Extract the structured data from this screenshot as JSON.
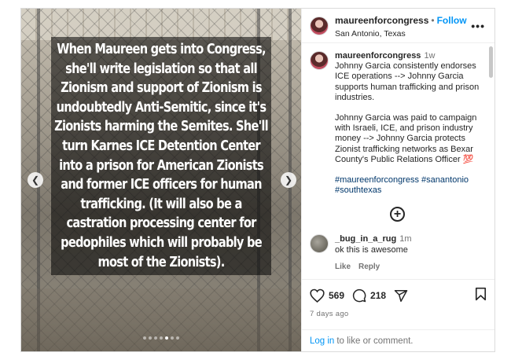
{
  "post": {
    "caption_image_text": "When Maureen gets into Congress, she'll write legislation so that all Zionism and support of Zionism is undoubtedly Anti-Semitic, since it's Zionists harming the Semites. She'll turn Karnes ICE Detention Center into a prison for American Zionists and former ICE officers for human trafficking. (It will also be a castration processing center for pedophiles which will probably be most of the Zionists).",
    "carousel": {
      "count": 7,
      "active": 5,
      "prev_icon": "chevron-left-icon",
      "next_icon": "chevron-right-icon"
    }
  },
  "header": {
    "username": "maureenforcongress",
    "separator": "•",
    "follow_label": "Follow",
    "location": "San Antonio, Texas",
    "more_icon": "ellipsis-icon",
    "more_label": "•••"
  },
  "caption_comment": {
    "username": "maureenforcongress",
    "time": "1w",
    "paragraph1": "Johnny Garcia consistently endorses ICE operations --> Johnny Garcia supports human trafficking and prison industries.",
    "paragraph2": "Johnny Garcia was paid to campaign with Israeli, ICE, and prison industry money --> Johnny Garcia protects Zionist trafficking networks as Bexar County's Public Relations Officer 💯",
    "hashtags": "#maureenforcongress #sanantonio #southtexas"
  },
  "load_more": {
    "icon": "plus-circle-icon",
    "label": "+"
  },
  "comment": {
    "username": "_bug_in_a_rug",
    "time": "1m",
    "text": "ok this is awesome",
    "like_label": "Like",
    "reply_label": "Reply"
  },
  "stats": {
    "likes": "569",
    "comments": "218",
    "posted": "7 days ago"
  },
  "footer": {
    "login_link": "Log in",
    "login_rest": "to like or comment."
  },
  "colors": {
    "accent": "#0095f6",
    "text": "#262626",
    "muted": "#737373",
    "border": "#dbdbdb"
  }
}
